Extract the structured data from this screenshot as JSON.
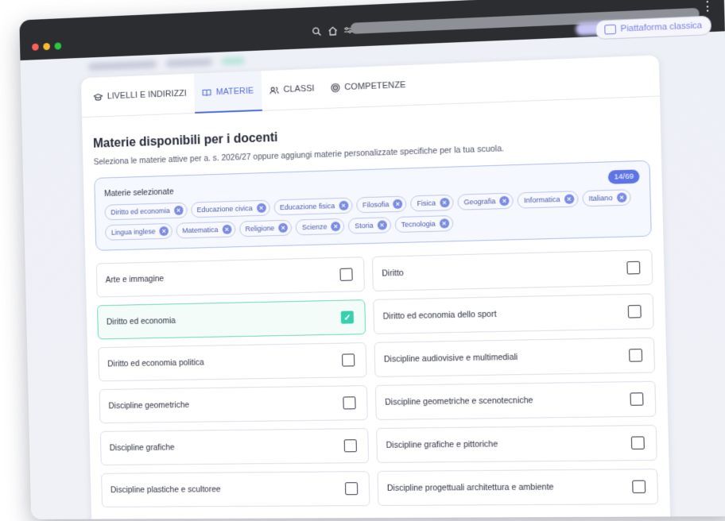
{
  "browser": {
    "traffic_lights": [
      "close",
      "minimize",
      "maximize"
    ]
  },
  "header": {
    "old_platform_label": "Piattaforma classica"
  },
  "tabs": [
    {
      "label": "LIVELLI E INDIRIZZI",
      "icon": "graduation-cap-icon"
    },
    {
      "label": "MATERIE",
      "icon": "book-icon",
      "active": true
    },
    {
      "label": "CLASSI",
      "icon": "users-icon"
    },
    {
      "label": "COMPETENZE",
      "icon": "target-icon"
    }
  ],
  "main": {
    "title": "Materie disponibili per i docenti",
    "subtitle": "Seleziona le materie attive per a. s. 2026/27 oppure aggiungi materie personalizzate specifiche per la tua scuola."
  },
  "selected": {
    "label": "Materie selezionate",
    "count": "14/69",
    "chips": [
      "Diritto ed economia",
      "Educazione civica",
      "Educazione fisica",
      "Filosofia",
      "Fisica",
      "Geografia",
      "Informatica",
      "Italiano",
      "Lingua inglese",
      "Matematica",
      "Religione",
      "Scienze",
      "Storia",
      "Tecnologia"
    ]
  },
  "subjects": [
    {
      "label": "Arte e immagine",
      "checked": false
    },
    {
      "label": "Diritto",
      "checked": false
    },
    {
      "label": "Diritto ed economia",
      "checked": true
    },
    {
      "label": "Diritto ed economia dello sport",
      "checked": false
    },
    {
      "label": "Diritto ed economia politica",
      "checked": false
    },
    {
      "label": "Discipline audiovisive e multimediali",
      "checked": false
    },
    {
      "label": "Discipline geometriche",
      "checked": false
    },
    {
      "label": "Discipline geometriche e scenotecniche",
      "checked": false
    },
    {
      "label": "Discipline grafiche",
      "checked": false
    },
    {
      "label": "Discipline grafiche e pittoriche",
      "checked": false
    },
    {
      "label": "Discipline plastiche e scultoree",
      "checked": false
    },
    {
      "label": "Discipline progettuali architettura e ambiente",
      "checked": false
    }
  ],
  "colors": {
    "accent": "#4f6bd8",
    "check": "#37d0ac",
    "chrome": "#2b2d31"
  }
}
